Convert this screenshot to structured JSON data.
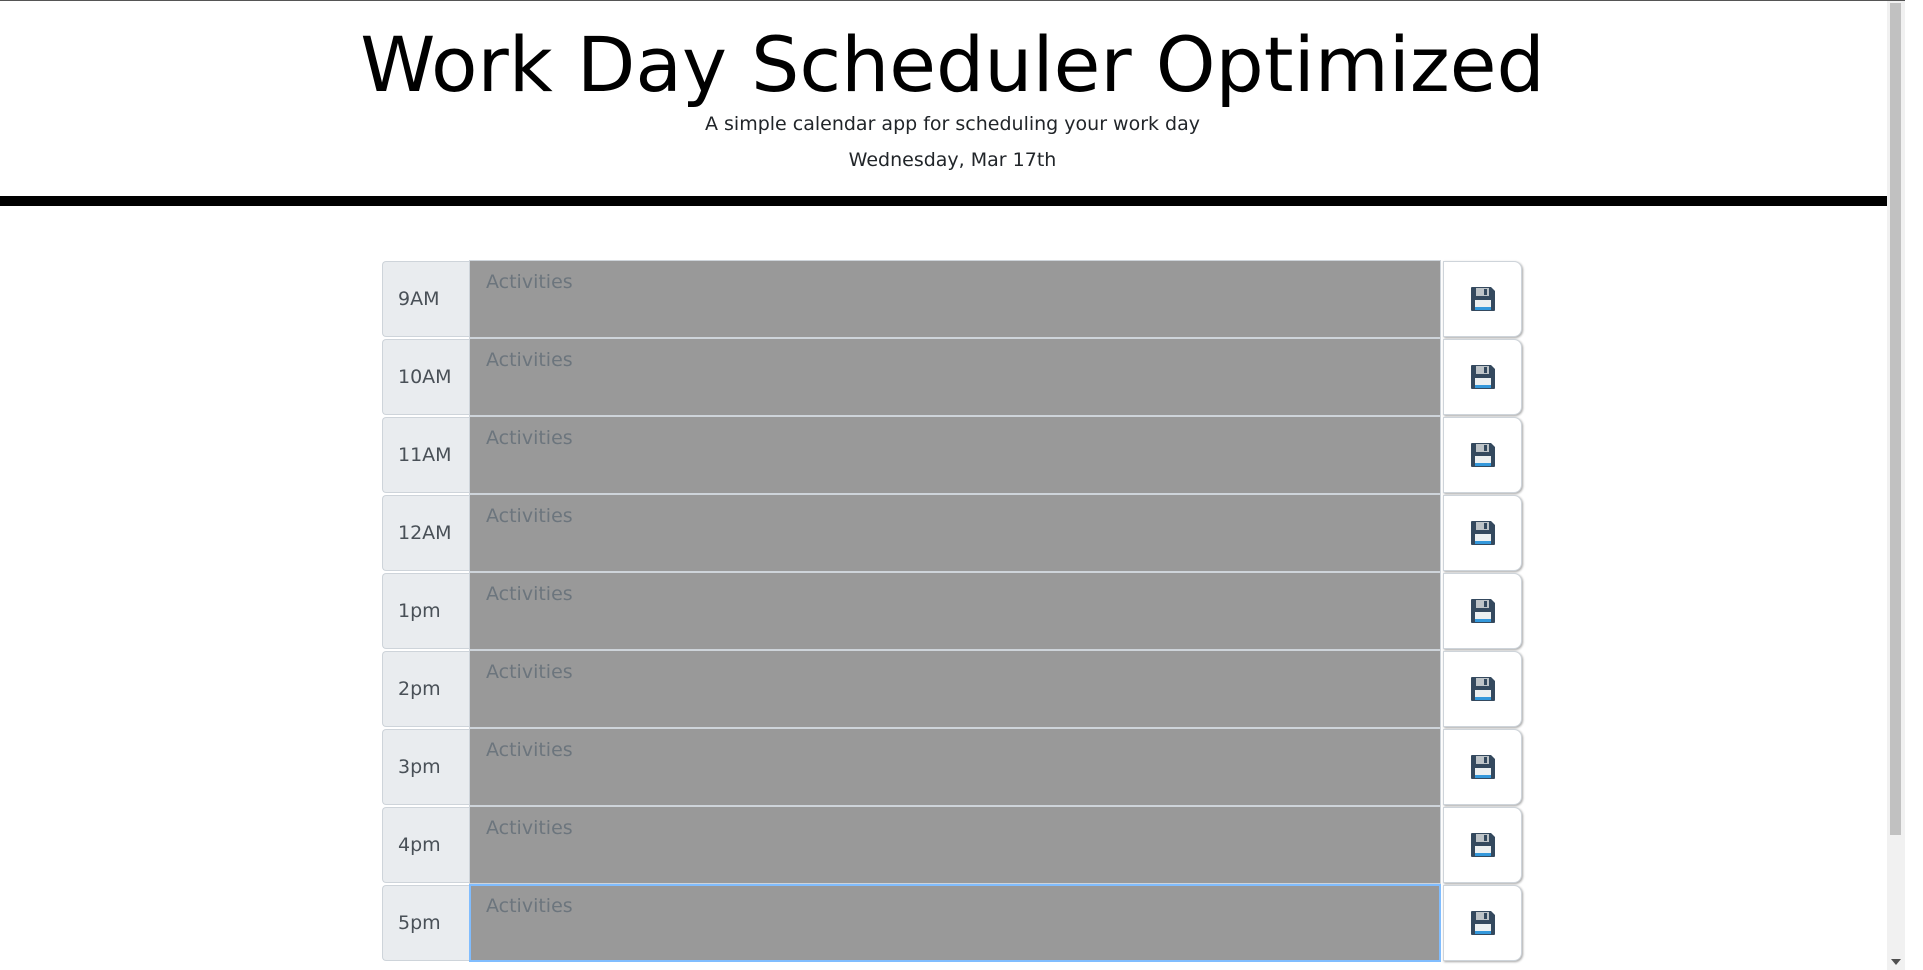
{
  "header": {
    "title": "Work Day Scheduler Optimized",
    "subtitle": "A simple calendar app for scheduling your work day",
    "current_day": "Wednesday, Mar 17th"
  },
  "schedule": {
    "placeholder": "Activities",
    "rows": [
      {
        "hour": "9AM",
        "value": ""
      },
      {
        "hour": "10AM",
        "value": ""
      },
      {
        "hour": "11AM",
        "value": ""
      },
      {
        "hour": "12AM",
        "value": ""
      },
      {
        "hour": "1pm",
        "value": ""
      },
      {
        "hour": "2pm",
        "value": ""
      },
      {
        "hour": "3pm",
        "value": ""
      },
      {
        "hour": "4pm",
        "value": ""
      },
      {
        "hour": "5pm",
        "value": ""
      }
    ],
    "focused_row": "5pm"
  },
  "icons": {
    "save": "floppy-disk-icon"
  },
  "colors": {
    "past_row": "#999999",
    "hour_bg": "#e9ecef",
    "header_rule": "#000000",
    "floppy_body": "#34495e",
    "floppy_label": "#3498db"
  }
}
